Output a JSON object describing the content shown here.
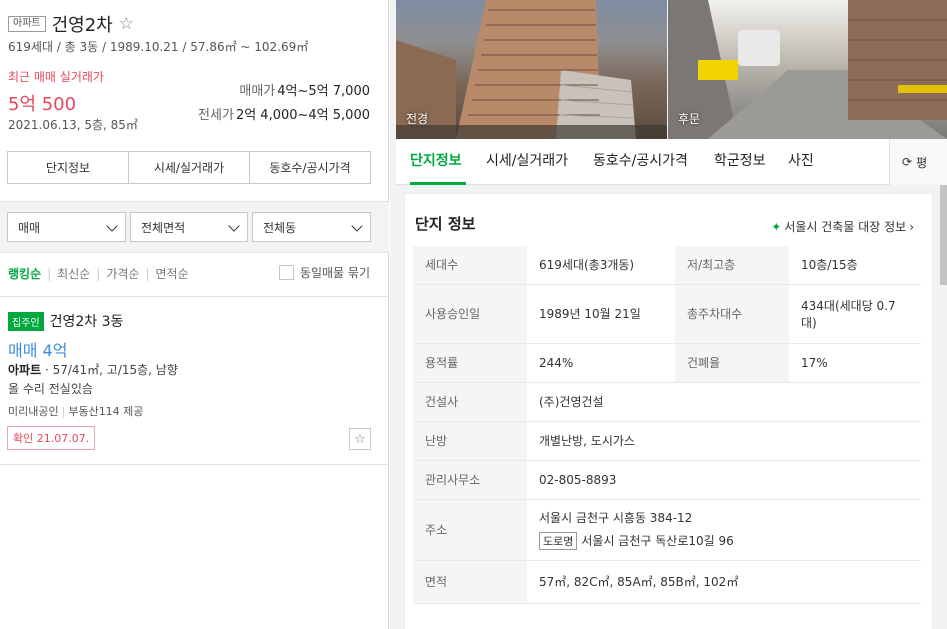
{
  "left": {
    "type_tag": "아파트",
    "name": "건영2차",
    "summary": "619세대 / 총 3동 / 1989.10.21 / 57.86㎡ ~ 102.69㎡",
    "recent_label": "최근 매매 실거래가",
    "recent_price": "5억 500",
    "recent_date": "2021.06.13, 5층, 85㎡",
    "sale_label": "매매가",
    "sale_range": "4억~5억 7,000",
    "jeonse_label": "전세가",
    "jeonse_range": "2억 4,000~4억 5,000",
    "tabs": [
      "단지정보",
      "시세/실거래가",
      "동호수/공시가격"
    ],
    "filters": [
      "매매",
      "전체면적",
      "전체동"
    ],
    "sorts": [
      "랭킹순",
      "최신순",
      "가격순",
      "면적순"
    ],
    "same_listing_label": "동일매물 묶기",
    "listing": {
      "badge": "집주인",
      "title": "건영2차 3동",
      "price": "매매 4억",
      "spec_type": "아파트",
      "spec_rest": " · 57/41㎡, 고/15층, 남향",
      "desc": "올 수리 전실있슴",
      "agent": "미리내공인",
      "source": "부동산114 제공",
      "confirm": "확인 21.07.07."
    }
  },
  "right": {
    "photos": [
      {
        "label": "전경"
      },
      {
        "label": "후문"
      }
    ],
    "tabs": [
      "단지정보",
      "시세/실거래가",
      "동호수/공시가격",
      "학군정보",
      "사진"
    ],
    "refresh_label": "평",
    "info_title": "단지 정보",
    "registry_link": "서울시 건축물 대장 정보",
    "table": {
      "households_label": "세대수",
      "households": "619세대(총3개동)",
      "floors_label": "저/최고층",
      "floors": "10층/15층",
      "approval_label": "사용승인일",
      "approval": "1989년 10월 21일",
      "parking_label": "총주차대수",
      "parking": "434대(세대당 0.7대)",
      "far_label": "용적률",
      "far": "244%",
      "bcr_label": "건폐율",
      "bcr": "17%",
      "builder_label": "건설사",
      "builder": "(주)건영건설",
      "heating_label": "난방",
      "heating": "개별난방, 도시가스",
      "office_label": "관리사무소",
      "office": "02-805-8893",
      "address_label": "주소",
      "address": "서울시 금천구 시흥동 384-12",
      "road_tag": "도로명",
      "road_address": "서울시 금천구 독산로10길 96",
      "area_label": "면적",
      "area": "57㎡, 82C㎡, 85A㎡, 85B㎡, 102㎡"
    }
  }
}
